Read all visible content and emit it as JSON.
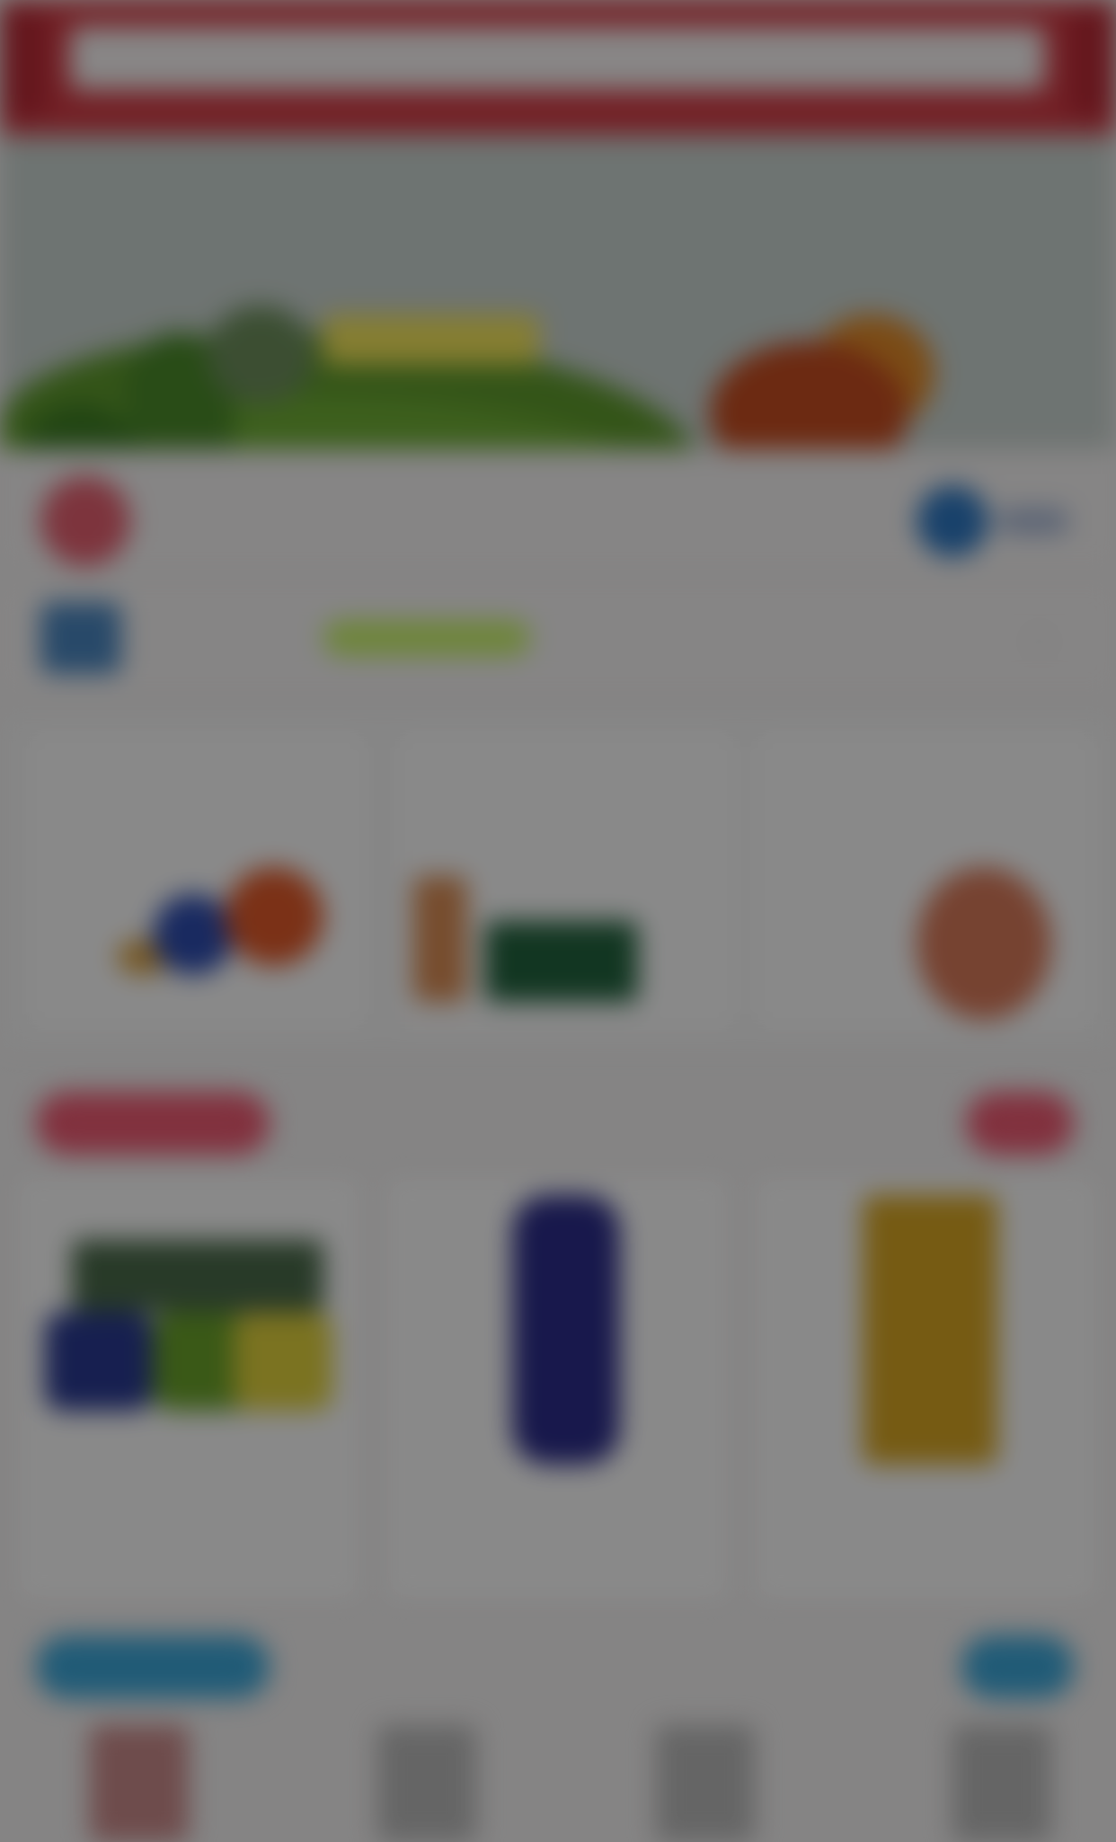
{
  "header": {
    "search_placeholder": "",
    "accent_color": "#d13b45"
  },
  "banner": {
    "title": ""
  },
  "location_row": {
    "title": "",
    "subtitle": ""
  },
  "notice_row": {
    "label": "",
    "tag": ""
  },
  "categories": [
    {
      "title": "",
      "subtitle": ""
    },
    {
      "title": "",
      "subtitle": ""
    },
    {
      "title": "",
      "subtitle": ""
    }
  ],
  "section1": {
    "title": "",
    "more": "",
    "color": "#ec5a72",
    "products": [
      {
        "name": "",
        "price": ""
      },
      {
        "name": "",
        "price": ""
      },
      {
        "name": "",
        "price": ""
      }
    ]
  },
  "section2": {
    "title": "",
    "more": "",
    "color": "#3ca6d8"
  }
}
